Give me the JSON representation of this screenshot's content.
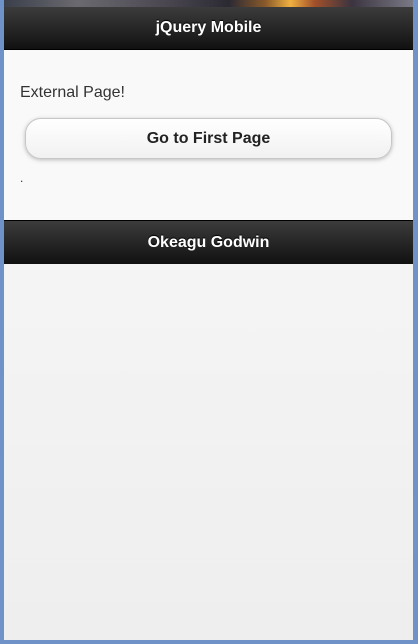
{
  "header": {
    "title": "jQuery Mobile"
  },
  "content": {
    "text": "External Page!",
    "button_label": "Go to First Page",
    "trailing_text": "."
  },
  "footer": {
    "title": "Okeagu Godwin"
  },
  "colors": {
    "bar_background": "#1f1f1f",
    "page_background": "#f9f9f9",
    "frame": "#6f92c8"
  }
}
